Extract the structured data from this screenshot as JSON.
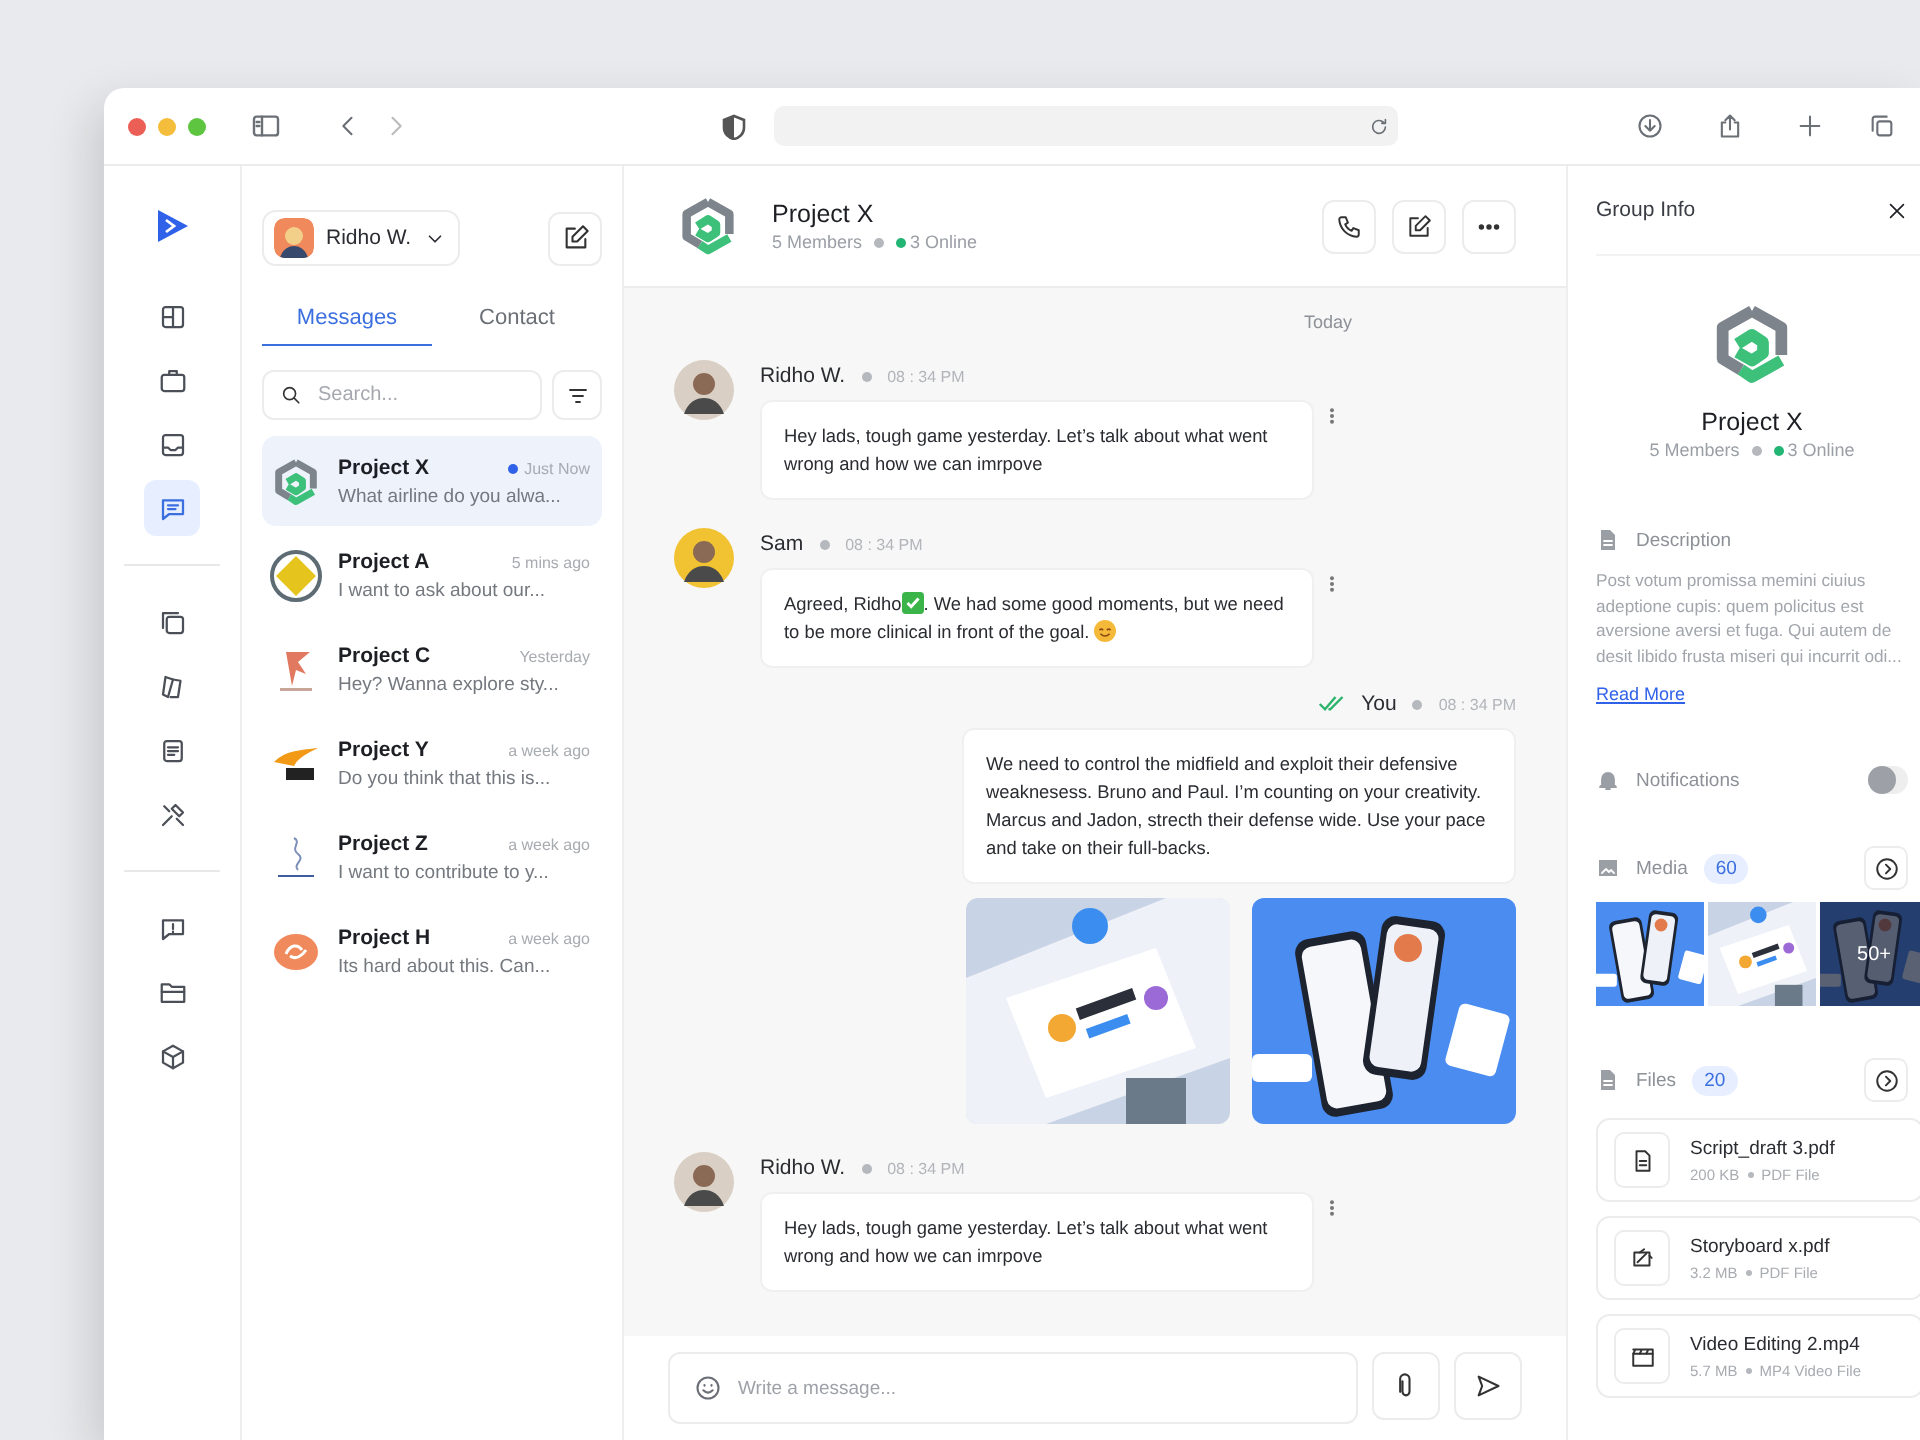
{
  "rail": [
    {
      "selected": false
    },
    {
      "selected": false
    },
    {
      "selected": false
    },
    {
      "selected": true
    },
    {
      "selected": false
    },
    {
      "selected": false
    },
    {
      "selected": false
    },
    {
      "selected": false
    },
    {
      "selected": false
    },
    {
      "selected": false
    },
    {
      "selected": false
    }
  ],
  "sidebar": {
    "user": {
      "name": "Ridho W."
    },
    "tabs": [
      {
        "label": "Messages",
        "selected": true
      },
      {
        "label": "Contact",
        "selected": false
      }
    ],
    "search": {
      "placeholder": "Search..."
    },
    "chats": [
      {
        "name": "Project X",
        "time": "Just Now",
        "preview": "What airline do you alwa...",
        "selected": true,
        "unread": true
      },
      {
        "name": "Project A",
        "time": "5 mins ago",
        "preview": "I want to ask about our...",
        "selected": false,
        "unread": false
      },
      {
        "name": "Project C",
        "time": "Yesterday",
        "preview": "Hey? Wanna explore sty...",
        "selected": false,
        "unread": false
      },
      {
        "name": "Project Y",
        "time": "a week ago",
        "preview": "Do you think that this is...",
        "selected": false,
        "unread": false
      },
      {
        "name": "Project Z",
        "time": "a week ago",
        "preview": "I want to contribute to y...",
        "selected": false,
        "unread": false
      },
      {
        "name": "Project H",
        "time": "a week ago",
        "preview": "Its hard about this. Can...",
        "selected": false,
        "unread": false
      }
    ]
  },
  "chat": {
    "title": "Project X",
    "members": "5 Members",
    "online": "3 Online",
    "date": "Today",
    "messages": [
      {
        "kind": "incoming",
        "author": "Ridho W.",
        "time": "08 : 34 PM",
        "color": "#d9cfc4",
        "parts": [
          {
            "kind": "text",
            "text": "Hey lads, tough game yesterday. Let’s talk about what went wrong and how we can imrpove"
          }
        ]
      },
      {
        "kind": "incoming",
        "author": "Sam",
        "time": "08 : 34 PM",
        "color": "#f1c232",
        "parts": [
          {
            "kind": "text",
            "text": "Agreed, Ridho"
          },
          {
            "kind": "check-emoji"
          },
          {
            "kind": "text",
            "text": ". We had some good moments, but we need to be more clinical in front of the goal. "
          },
          {
            "kind": "smile-emoji"
          }
        ]
      },
      {
        "kind": "outgoing",
        "author": "You",
        "time": "08 : 34 PM",
        "read": true,
        "parts": [
          {
            "kind": "text",
            "text": "We need to control the midfield and exploit their defensive weaknesess. Bruno and Paul. I’m counting on your creativity. Marcus and Jadon, strecth their defense wide. Use your pace and take on their full-backs."
          }
        ],
        "attachments": [
          {
            "kind": "picture"
          },
          {
            "kind": "picture"
          }
        ]
      },
      {
        "kind": "incoming",
        "author": "Ridho W.",
        "time": "08 : 34 PM",
        "color": "#d9cfc4",
        "parts": [
          {
            "kind": "text",
            "text": "Hey lads, tough game yesterday. Let’s talk about what went wrong and how we can imrpove"
          }
        ]
      }
    ],
    "composer": {
      "placeholder": "Write a message..."
    }
  },
  "info": {
    "title": "Group Info",
    "name": "Project X",
    "members": "5 Members",
    "online": "3 Online",
    "description": {
      "heading": "Description",
      "text": "Post votum promissa memini ciuius adeptione cupis: quem policitus est aversione aversi et fuga. Qui autem de desit libido frusta miseri qui incurrit odi...",
      "link": "Read More"
    },
    "notifications": {
      "label": "Notifications",
      "on": false
    },
    "media": {
      "label": "Media",
      "count": "60",
      "more": "50+"
    },
    "files": {
      "label": "Files",
      "count": "20",
      "items": [
        {
          "name": "Script_draft 3.pdf",
          "size": "200 KB",
          "type": "PDF File"
        },
        {
          "name": "Storyboard x.pdf",
          "size": "3.2 MB",
          "type": "PDF File"
        },
        {
          "name": "Video Editing 2.mp4",
          "size": "5.7 MB",
          "type": "MP4 Video File"
        }
      ]
    }
  }
}
